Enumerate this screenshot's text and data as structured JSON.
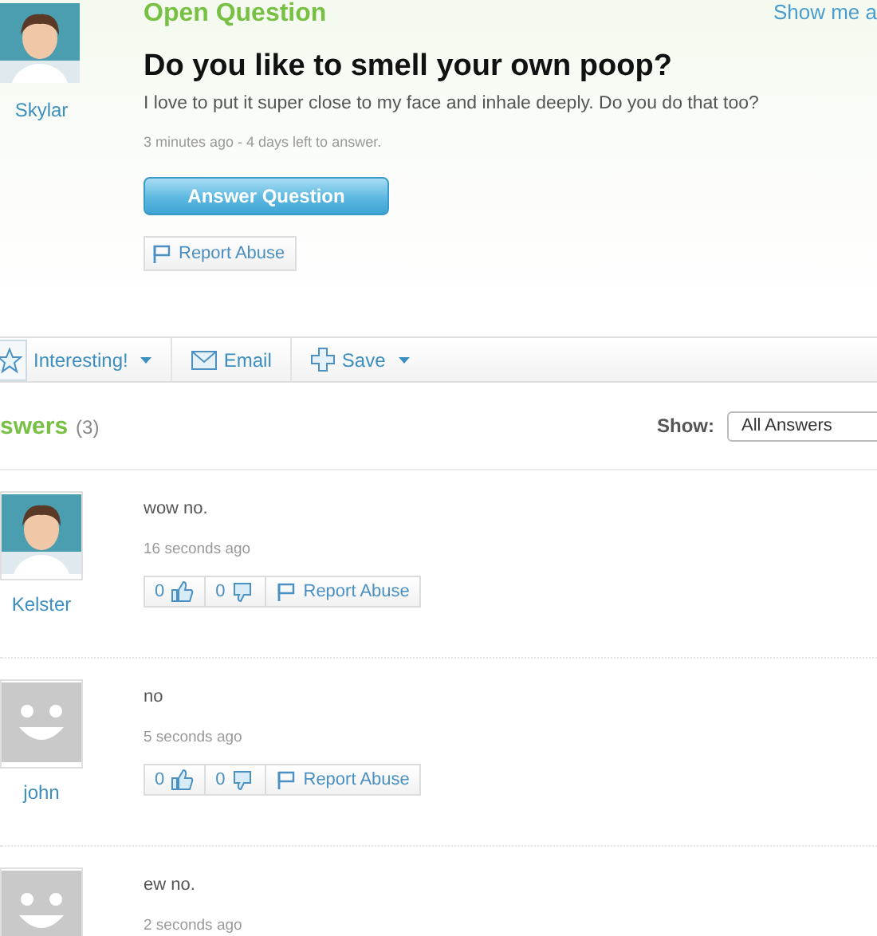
{
  "question": {
    "status": "Open Question",
    "asker": "Skylar",
    "avatar": {
      "kind": "custom"
    },
    "title": "Do you like to smell your own poop?",
    "details": "I love to put it super close to my face and inhale deeply. Do you do that too?",
    "meta": "3 minutes ago - 4 days left to answer.",
    "answer_button": "Answer Question",
    "report_button": "Report Abuse"
  },
  "top_link": "Show me a",
  "toolbar": [
    {
      "label": "Interesting!",
      "kind": "star",
      "menu": true
    },
    {
      "label": "Email",
      "kind": "email",
      "menu": false
    },
    {
      "label": "Save",
      "kind": "save",
      "menu": true
    }
  ],
  "answers_header": {
    "title": "swers",
    "count": "(3)",
    "show_label": "Show:",
    "filter": "All Answers"
  },
  "answers": [
    {
      "user": "Kelster",
      "avatar": {
        "kind": "custom"
      },
      "text": "wow no.",
      "time": "16 seconds ago",
      "up": "0",
      "down": "0",
      "report": "Report Abuse"
    },
    {
      "user": "john",
      "avatar": {
        "kind": "default"
      },
      "text": "no",
      "time": "5 seconds ago",
      "up": "0",
      "down": "0",
      "report": "Report Abuse"
    },
    {
      "avatar": {
        "kind": "default"
      },
      "text": "ew no.",
      "time": "2 seconds ago"
    }
  ]
}
